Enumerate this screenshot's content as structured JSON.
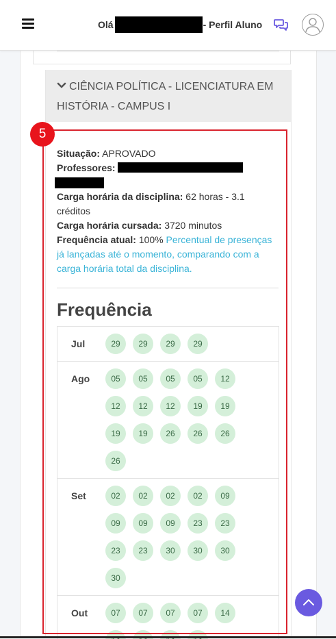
{
  "header": {
    "greeting_prefix": "Olá",
    "greeting_suffix": "- Perfil Aluno",
    "icons": [
      "menu-icon",
      "chat-icon",
      "user-avatar-icon"
    ]
  },
  "course": {
    "title": "CIÊNCIA POLÍTICA - LICENCIATURA EM HISTÓRIA - CAMPUS I",
    "badge_number": "5",
    "situacao_label": "Situação:",
    "situacao_value": "APROVADO",
    "professores_label": "Professores:",
    "carga_disciplina_label": "Carga horária da disciplina:",
    "carga_disciplina_value": "62 horas - 3.1 créditos",
    "carga_cursada_label": "Carga horária cursada:",
    "carga_cursada_value": "3720 minutos",
    "frequencia_label": "Frequência atual:",
    "frequencia_value": "100%",
    "frequencia_note": "Percentual de presenças já lançadas até o momento, comparando com a carga horária total da disciplina."
  },
  "frequency": {
    "title": "Frequência",
    "months": [
      {
        "name": "Jul",
        "days": [
          "29",
          "29",
          "29",
          "29"
        ]
      },
      {
        "name": "Ago",
        "days": [
          "05",
          "05",
          "05",
          "05",
          "12",
          "12",
          "12",
          "12",
          "19",
          "19",
          "19",
          "19",
          "26",
          "26",
          "26",
          "26"
        ]
      },
      {
        "name": "Set",
        "days": [
          "02",
          "02",
          "02",
          "02",
          "09",
          "09",
          "09",
          "09",
          "23",
          "23",
          "23",
          "23",
          "30",
          "30",
          "30",
          "30"
        ]
      },
      {
        "name": "Out",
        "days": [
          "07",
          "07",
          "07",
          "07",
          "14",
          "14",
          "14",
          "14",
          "14"
        ]
      }
    ]
  },
  "colors": {
    "highlight": "#d9232d",
    "badge": "#e8141c",
    "day_bg": "#d4efd9",
    "note_link": "#39b3d7",
    "scroll_top": "#6a5ae0"
  }
}
